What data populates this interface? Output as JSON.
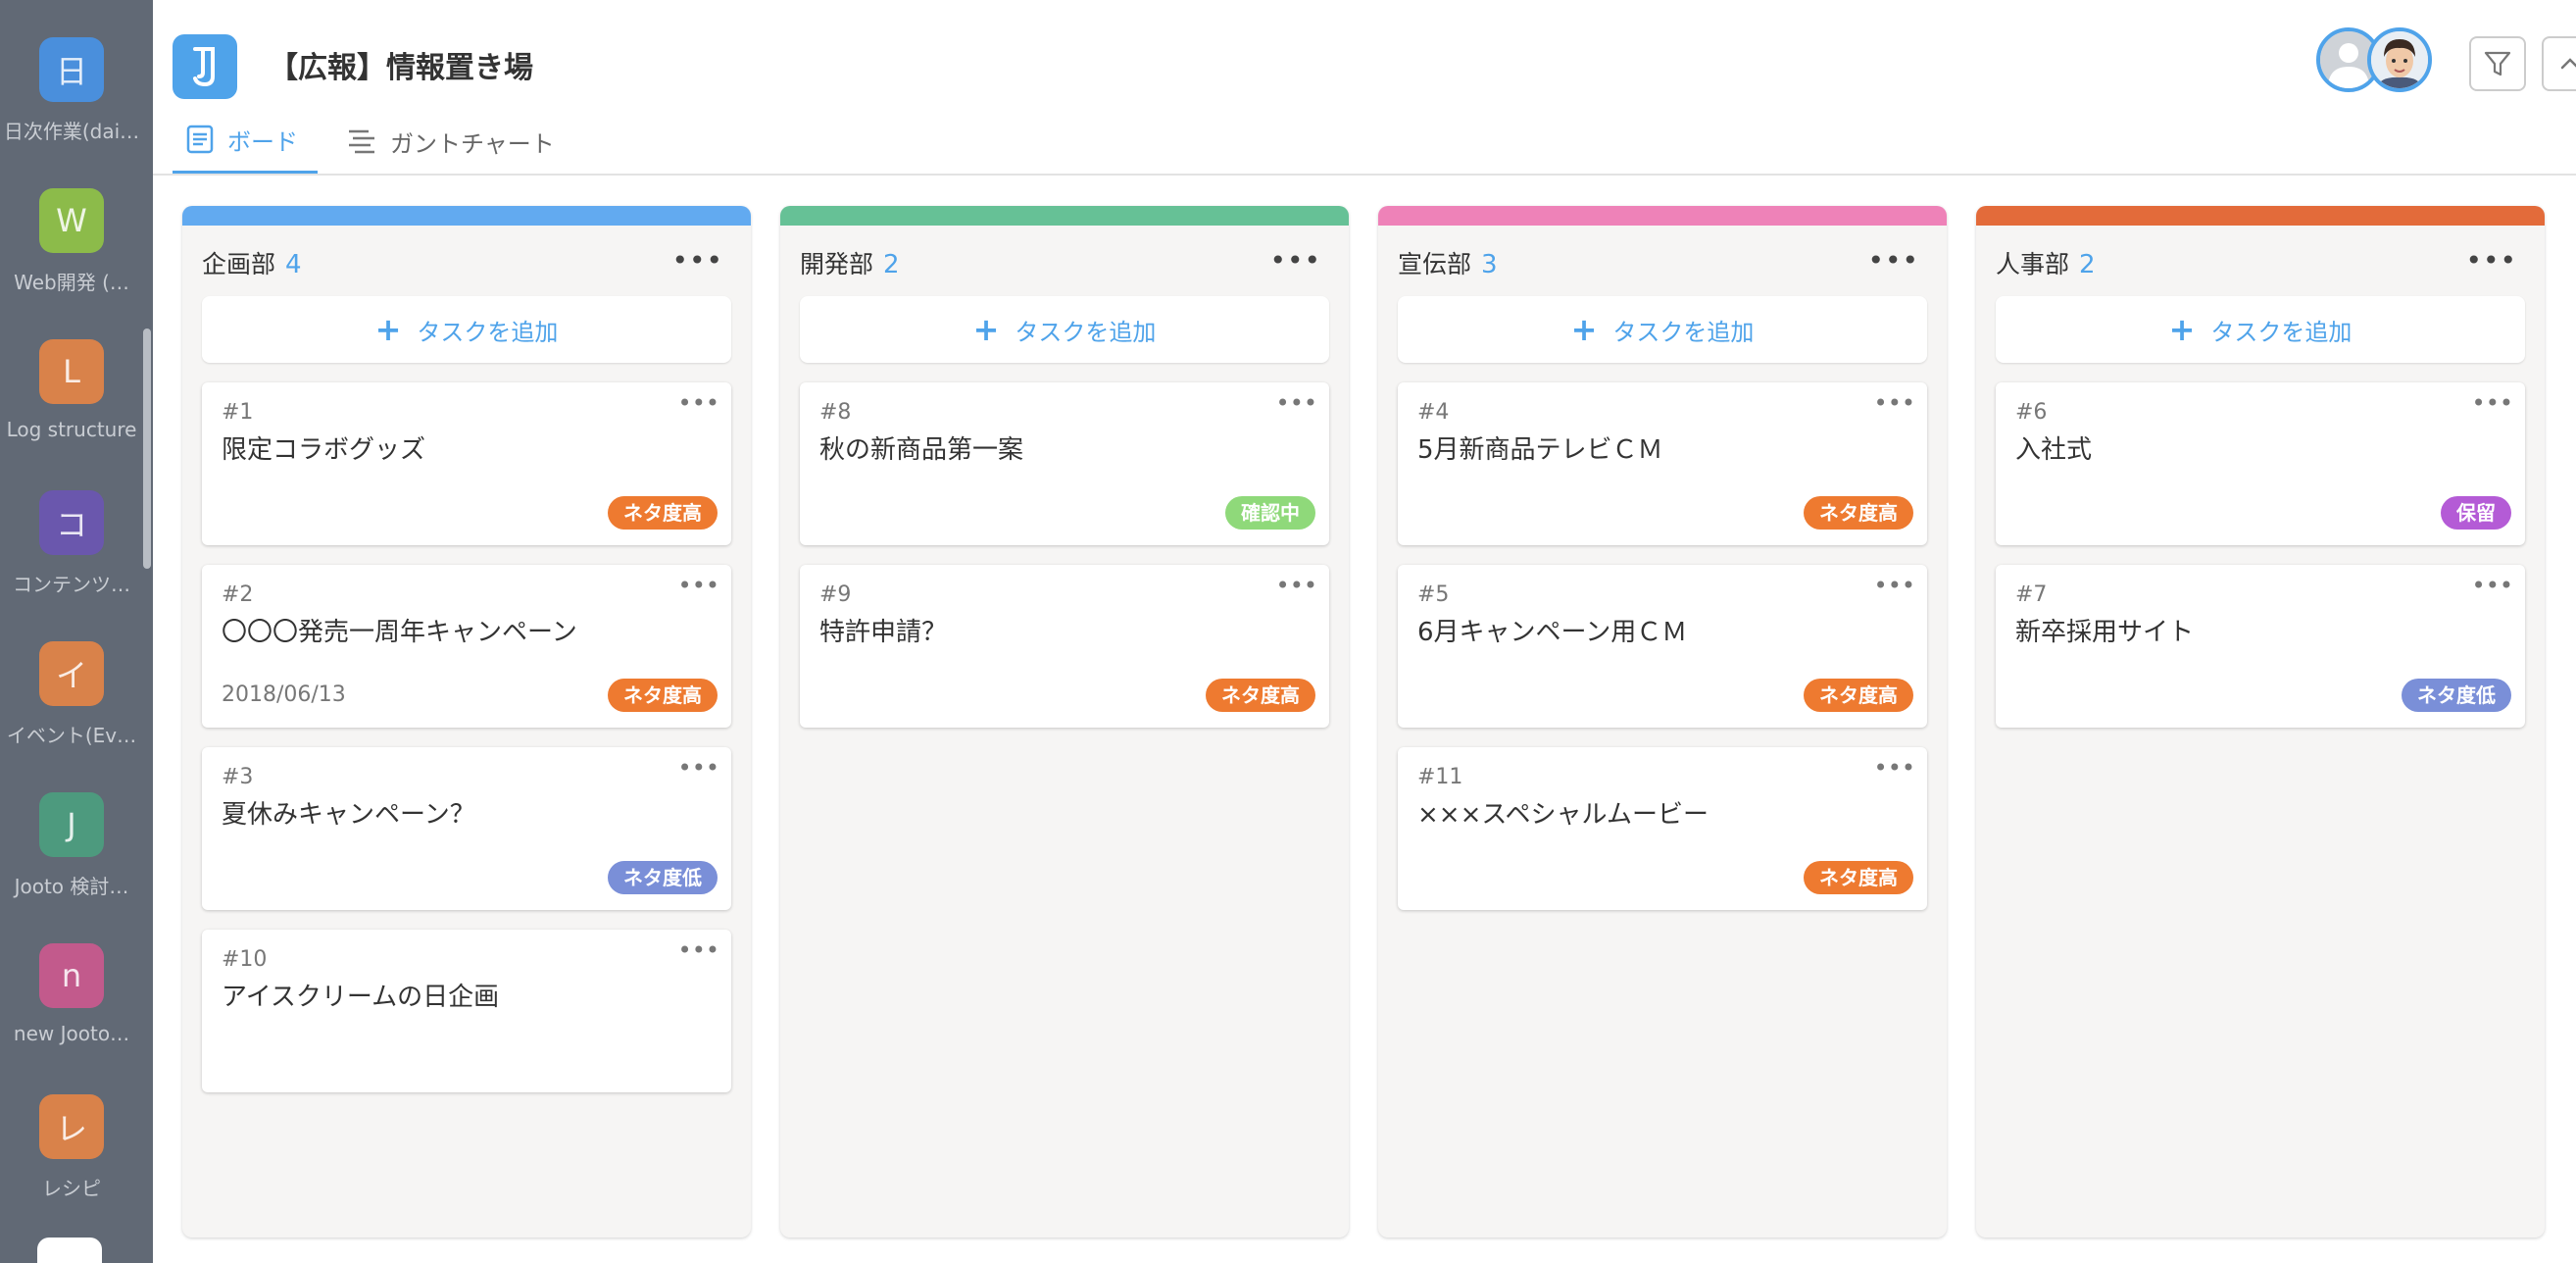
{
  "sidebar": {
    "projects": [
      {
        "initial": "日",
        "label": "日次作業(dai…",
        "color": "#4a8fdc"
      },
      {
        "initial": "W",
        "label": "Web開発 (…",
        "color": "#8cbb4a"
      },
      {
        "initial": "L",
        "label": "Log structure",
        "color": "#d9824a"
      },
      {
        "initial": "コ",
        "label": "コンテンツ…",
        "color": "#6a57ad"
      },
      {
        "initial": "イ",
        "label": "イベント(Ev…",
        "color": "#d9824a"
      },
      {
        "initial": "J",
        "label": "Jooto 検討…",
        "color": "#4d9a7e"
      },
      {
        "initial": "n",
        "label": "new Jooto…",
        "color": "#c25a8c"
      },
      {
        "initial": "レ",
        "label": "レシピ",
        "color": "#d9824a"
      }
    ]
  },
  "header": {
    "board_title": "【広報】情報置き場",
    "tabs": [
      {
        "label": "ボード",
        "active": true
      },
      {
        "label": "ガントチャート",
        "active": false
      }
    ]
  },
  "board": {
    "add_task_label": "タスクを追加",
    "columns": [
      {
        "name": "企画部",
        "count": "4",
        "color": "#62aaf0",
        "cards": [
          {
            "num": "#1",
            "title": "限定コラボグッズ",
            "date": "",
            "badge": "ネタ度高",
            "badge_color": "#ee7a30"
          },
          {
            "num": "#2",
            "title": "〇〇〇発売一周年キャンペーン",
            "date": "2018/06/13",
            "badge": "ネタ度高",
            "badge_color": "#ee7a30"
          },
          {
            "num": "#3",
            "title": "夏休みキャンペーン？",
            "date": "",
            "badge": "ネタ度低",
            "badge_color": "#7a8fd8"
          },
          {
            "num": "#10",
            "title": "アイスクリームの日企画",
            "date": "",
            "badge": "",
            "badge_color": ""
          }
        ]
      },
      {
        "name": "開発部",
        "count": "2",
        "color": "#66c196",
        "cards": [
          {
            "num": "#8",
            "title": "秋の新商品第一案",
            "date": "",
            "badge": "確認中",
            "badge_color": "#8fd97a"
          },
          {
            "num": "#9",
            "title": "特許申請？",
            "date": "",
            "badge": "ネタ度高",
            "badge_color": "#ee7a30"
          }
        ]
      },
      {
        "name": "宣伝部",
        "count": "3",
        "color": "#ee82b8",
        "cards": [
          {
            "num": "#4",
            "title": "5月新商品テレビＣＭ",
            "date": "",
            "badge": "ネタ度高",
            "badge_color": "#ee7a30"
          },
          {
            "num": "#5",
            "title": "6月キャンペーン用ＣＭ",
            "date": "",
            "badge": "ネタ度高",
            "badge_color": "#ee7a30"
          },
          {
            "num": "#11",
            "title": "×××スペシャルムービー",
            "date": "",
            "badge": "ネタ度高",
            "badge_color": "#ee7a30"
          }
        ]
      },
      {
        "name": "人事部",
        "count": "2",
        "color": "#e36b3a",
        "cards": [
          {
            "num": "#6",
            "title": "入社式",
            "date": "",
            "badge": "保留",
            "badge_color": "#b45bd6"
          },
          {
            "num": "#7",
            "title": "新卒採用サイト",
            "date": "",
            "badge": "ネタ度低",
            "badge_color": "#7a8fd8"
          }
        ]
      }
    ]
  }
}
